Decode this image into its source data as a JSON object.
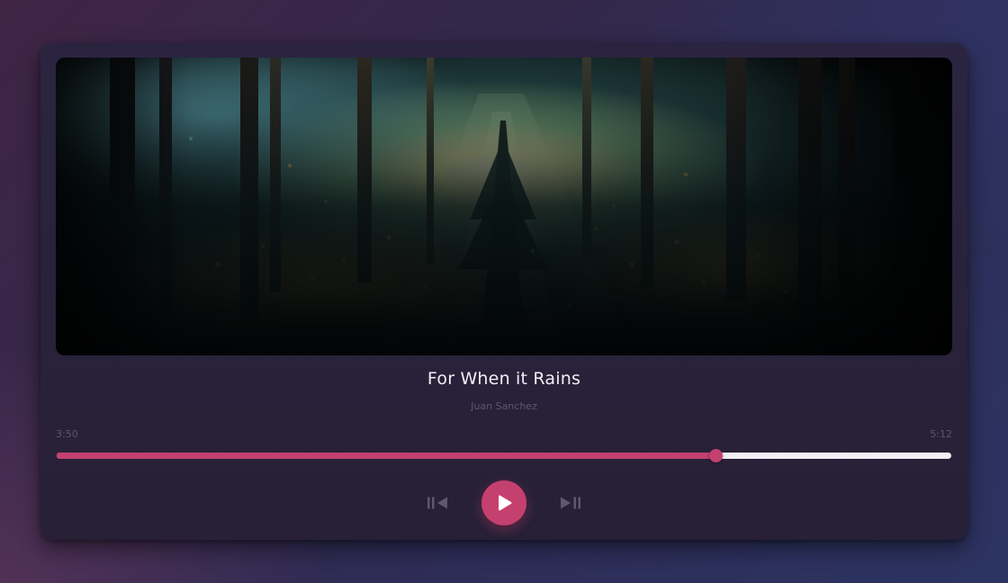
{
  "track": {
    "title": "For When it Rains",
    "artist": "Juan Sanchez",
    "current_time": "3:50",
    "total_time": "5:12",
    "progress_fraction": 0.737
  },
  "artwork": {
    "description_icon": "forest-artwork-image"
  },
  "controls": {
    "previous_icon": "skip-previous-icon",
    "play_icon": "play-icon",
    "next_icon": "skip-next-icon"
  },
  "colors": {
    "accent": "#c4406f",
    "card_bg": "#2b2440",
    "track_bg": "#f1eff3",
    "title_text": "#f1eef6",
    "muted_text": "#5e566f"
  }
}
